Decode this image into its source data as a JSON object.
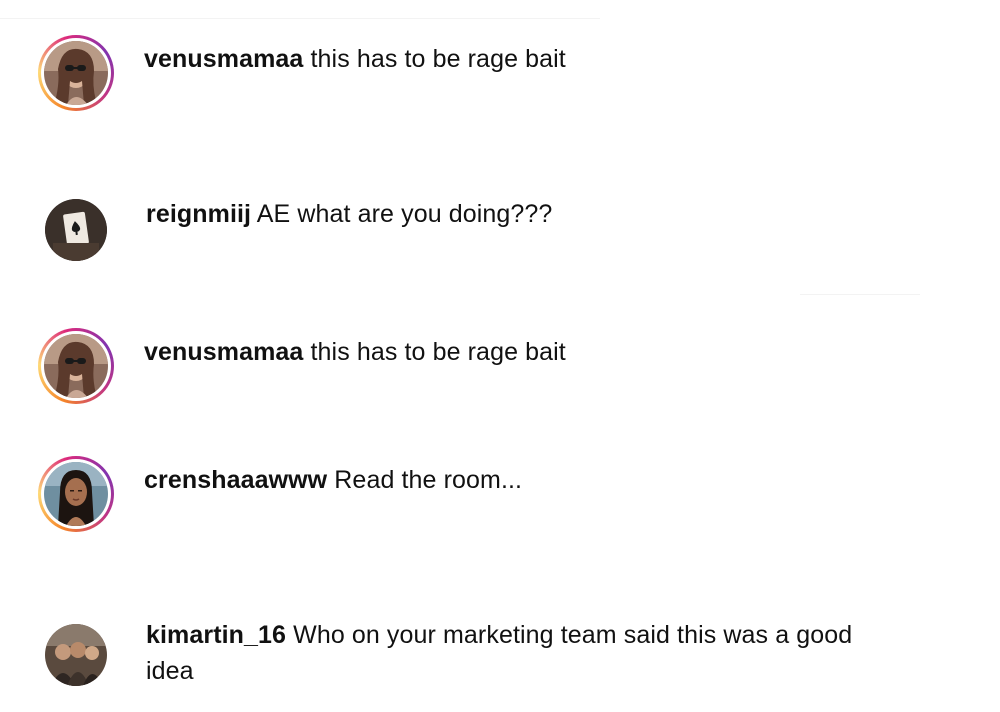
{
  "comments": [
    {
      "username": "venusmamaa",
      "text": "this has to be rage bait",
      "avatar": "woman-sunglasses-avatar",
      "story_ring": true
    },
    {
      "username": "reignmiij",
      "text": "AE what are you doing???",
      "avatar": "playing-card-avatar",
      "story_ring": false
    },
    {
      "username": "venusmamaa",
      "text": "this has to be rage bait",
      "avatar": "woman-sunglasses-avatar",
      "story_ring": true
    },
    {
      "username": "crenshaaawww",
      "text": "Read the room...",
      "avatar": "woman-long-hair-avatar",
      "story_ring": true
    },
    {
      "username": "kimartin_16",
      "text": "Who on your marketing team said this was a good idea",
      "avatar": "group-photo-avatar",
      "story_ring": false
    }
  ],
  "colors": {
    "text": "#111111",
    "background": "#ffffff",
    "story_ring_start": "#f58529",
    "story_ring_end": "#8134af"
  }
}
